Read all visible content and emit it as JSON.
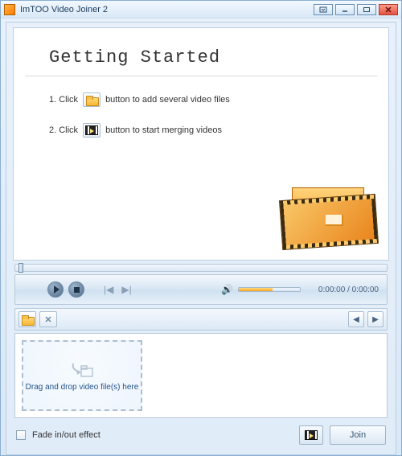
{
  "window": {
    "title": "ImTOO Video Joiner 2"
  },
  "getting_started": {
    "title": "Getting Started",
    "step1_prefix": "1. Click",
    "step1_suffix": "button to add several video files",
    "step2_prefix": "2. Click",
    "step2_suffix": "button to start merging videos"
  },
  "player": {
    "time_display": "0:00:00 / 0:00:00"
  },
  "drop_area": {
    "hint": "Drag and drop video file(s) here"
  },
  "bottom": {
    "fade_label": "Fade in/out effect",
    "join_label": "Join"
  }
}
